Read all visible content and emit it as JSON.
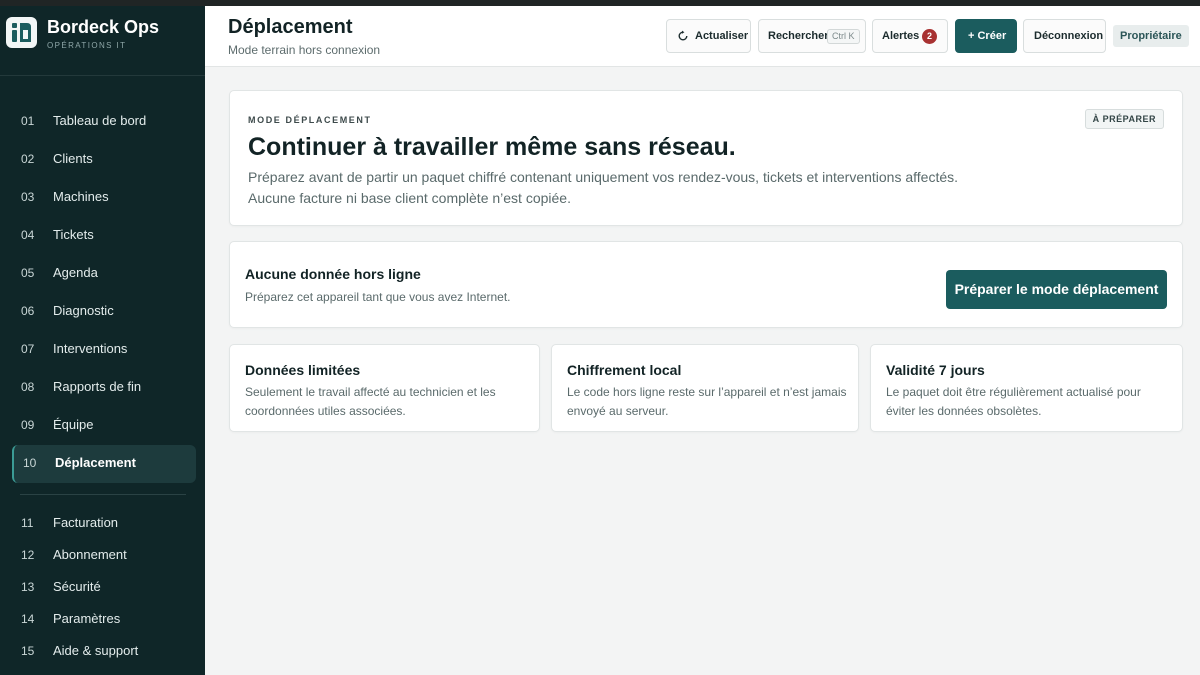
{
  "app": {
    "name": "Bordeck Ops",
    "subtitle": "OPÉRATIONS IT"
  },
  "sidebar": {
    "items": [
      {
        "num": "01",
        "label": "Tableau de bord"
      },
      {
        "num": "02",
        "label": "Clients"
      },
      {
        "num": "03",
        "label": "Machines"
      },
      {
        "num": "04",
        "label": "Tickets"
      },
      {
        "num": "05",
        "label": "Agenda"
      },
      {
        "num": "06",
        "label": "Diagnostic"
      },
      {
        "num": "07",
        "label": "Interventions"
      },
      {
        "num": "08",
        "label": "Rapports de fin"
      },
      {
        "num": "09",
        "label": "Équipe"
      },
      {
        "num": "10",
        "label": "Déplacement",
        "active": true
      }
    ],
    "secondary_items": [
      {
        "num": "11",
        "label": "Facturation"
      },
      {
        "num": "12",
        "label": "Abonnement"
      },
      {
        "num": "13",
        "label": "Sécurité"
      },
      {
        "num": "14",
        "label": "Paramètres"
      },
      {
        "num": "15",
        "label": "Aide & support"
      }
    ]
  },
  "header": {
    "title": "Déplacement",
    "subtitle": "Mode terrain hors connexion",
    "refresh_label": "Actualiser",
    "search_label": "Rechercher",
    "search_shortcut": "Ctrl K",
    "alerts_label": "Alertes",
    "alerts_count": "2",
    "create_label": "+ Créer",
    "logout_label": "Déconnexion",
    "role_label": "Propriétaire"
  },
  "hero": {
    "kicker": "MODE DÉPLACEMENT",
    "status": "À PRÉPARER",
    "title": "Continuer à travailler même sans réseau.",
    "description_line1": "Préparez avant de partir un paquet chiffré contenant uniquement vos rendez-vous, tickets et interventions affectés.",
    "description_line2": "Aucune facture ni base client complète n’est copiée."
  },
  "offline": {
    "title": "Aucune donnée hors ligne",
    "description": "Préparez cet appareil tant que vous avez Internet.",
    "button_label": "Préparer le mode déplacement"
  },
  "features": [
    {
      "title": "Données limitées",
      "description": "Seulement le travail affecté au technicien et les coordonnées utiles associées."
    },
    {
      "title": "Chiffrement local",
      "description": "Le code hors ligne reste sur l’appareil et n’est jamais envoyé au serveur."
    },
    {
      "title": "Validité 7 jours",
      "description": "Le paquet doit être régulièrement actualisé pour éviter les données obsolètes."
    }
  ],
  "colors": {
    "sidebar_bg": "#0f2628",
    "accent": "#1b5c5e",
    "alert_badge": "#a83232",
    "main_bg": "#f3f4f4"
  },
  "icons": {
    "logo": "bordeck-logo-icon",
    "refresh": "refresh-icon"
  }
}
